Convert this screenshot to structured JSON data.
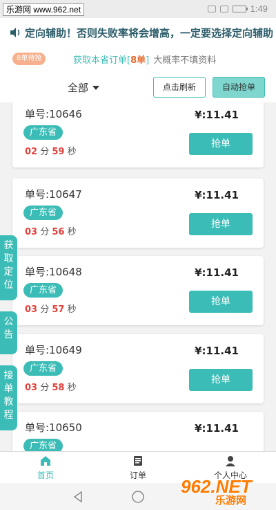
{
  "status": {
    "watermark": "乐游网 www.962.net",
    "time": "1:49"
  },
  "notice": {
    "text": "定向辅助！否则失败率将会增高，一定要选择定向辅助"
  },
  "info": {
    "pending_badge": "8单待抢",
    "prefix": "获取本省订单[",
    "count": "8单",
    "suffix": "]",
    "tip": "大概率不填资料"
  },
  "filter": {
    "selected": "全部",
    "refresh_label": "点击刷新",
    "auto_label": "自动抢单"
  },
  "orders": [
    {
      "no": "单号:10646",
      "province": "广东省",
      "min": "02",
      "sec": "59",
      "price": "¥:11.41",
      "btn": "抢单"
    },
    {
      "no": "单号:10647",
      "province": "广东省",
      "min": "03",
      "sec": "56",
      "price": "¥:11.41",
      "btn": "抢单"
    },
    {
      "no": "单号:10648",
      "province": "广东省",
      "min": "03",
      "sec": "57",
      "price": "¥:11.41",
      "btn": "抢单"
    },
    {
      "no": "单号:10649",
      "province": "广东省",
      "min": "03",
      "sec": "58",
      "price": "¥:11.41",
      "btn": "抢单"
    },
    {
      "no": "单号:10650",
      "province": "广东省",
      "min": "",
      "sec": "",
      "price": "¥:11.41",
      "btn": ""
    }
  ],
  "units": {
    "min": "分",
    "sec": "秒"
  },
  "side_tabs": {
    "location": "获取定位",
    "announcement": "公告",
    "tutorial": "接单教程"
  },
  "tabs": {
    "home": "首页",
    "orders": "订单",
    "profile": "个人中心"
  },
  "logo": {
    "main": "962.NET",
    "sub": "乐游网"
  },
  "colors": {
    "accent": "#3cbcb6",
    "countdown": "#e0433d",
    "badge": "#f6b08d"
  }
}
